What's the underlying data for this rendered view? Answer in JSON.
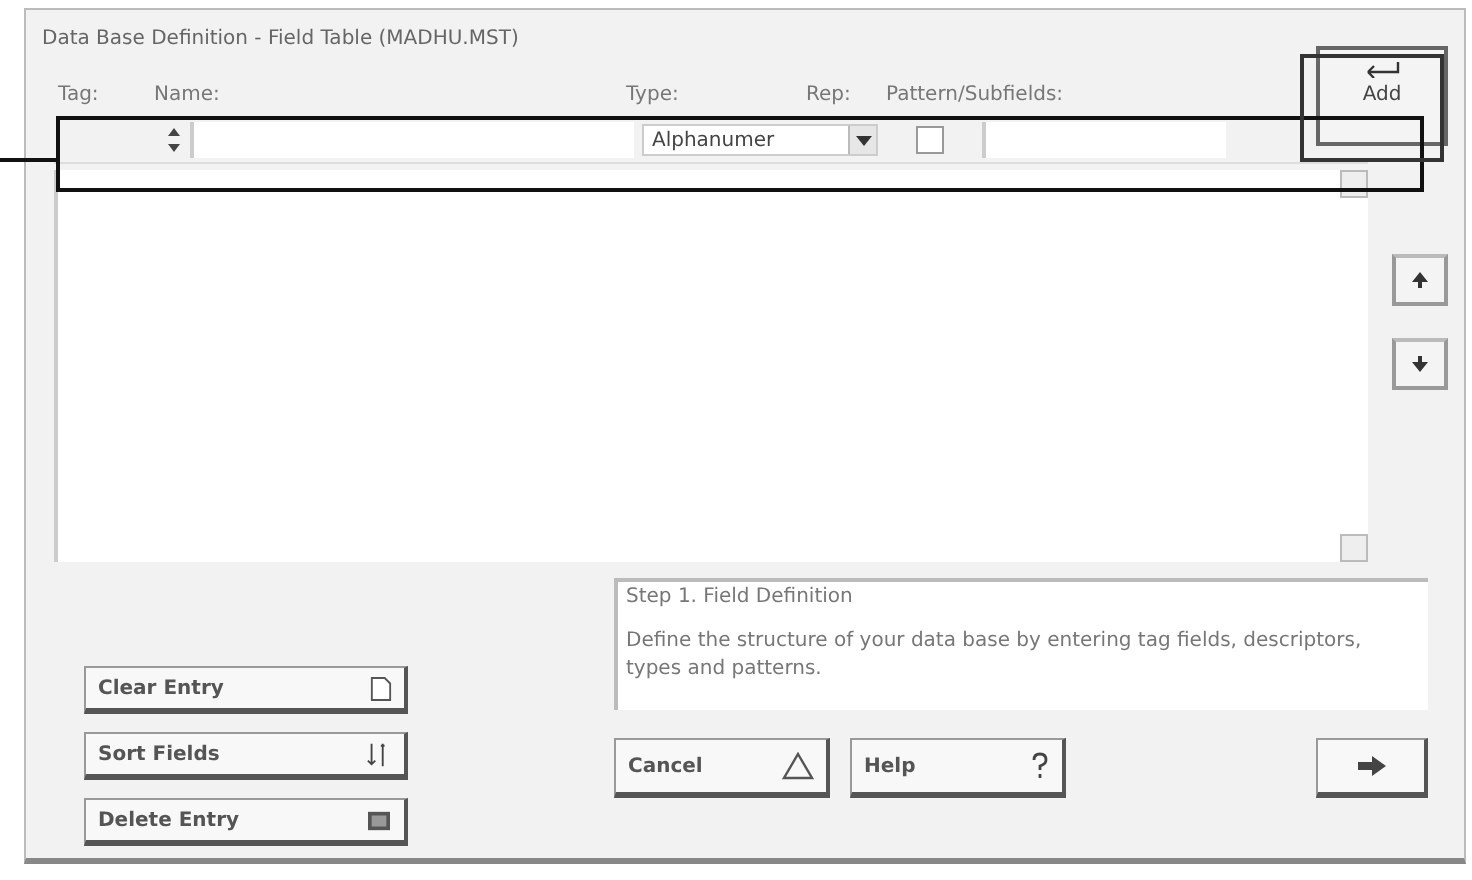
{
  "window": {
    "title": "Data Base Definition - Field Table (MADHU.MST)"
  },
  "columns": [
    "Tag:",
    "Name:",
    "Type:",
    "Rep:",
    "Pattern/Subfields:"
  ],
  "entry_row": {
    "type": "Alphanumer",
    "repeatable": false
  },
  "add_button": {
    "label": "Add"
  },
  "side_buttons": [
    {
      "kind": "up"
    },
    {
      "kind": "down"
    }
  ],
  "left_buttons": [
    {
      "label": "Clear Entry",
      "kind": "new"
    },
    {
      "label": "Sort Fields",
      "kind": "sort"
    },
    {
      "label": "Delete Entry",
      "kind": "delete"
    }
  ],
  "info": {
    "title": "Step 1. Field Definition",
    "body": "Define the structure of your data base by entering tag fields, descriptors, types and patterns."
  },
  "bottom_buttons": [
    {
      "label": "Cancel",
      "kind": "cancel"
    },
    {
      "label": "Help",
      "kind": "help"
    }
  ],
  "next_button": {
    "kind": "next"
  },
  "callout": {
    "kind": "box"
  }
}
